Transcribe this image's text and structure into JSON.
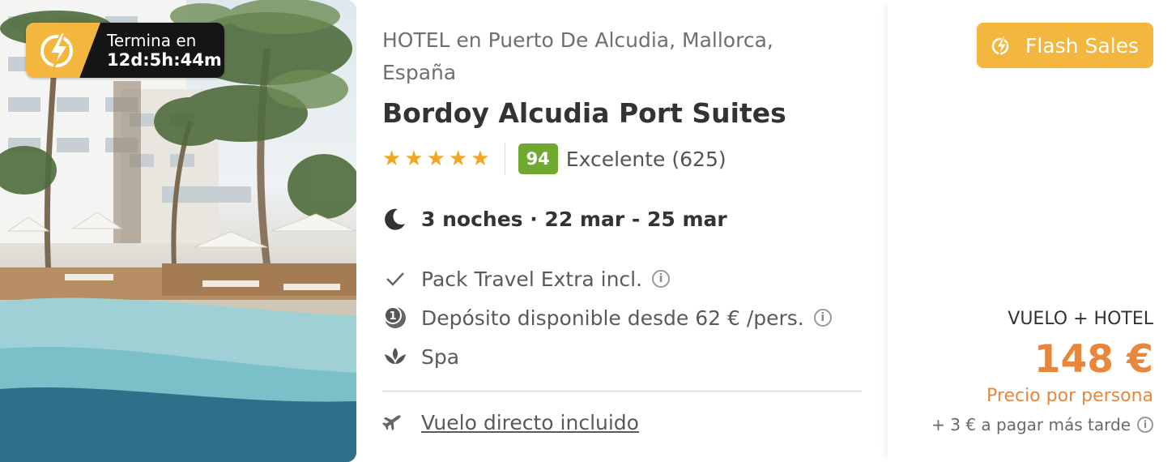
{
  "timer": {
    "label": "Termina en",
    "value": "12d:5h:44m",
    "icon": "flash-timer-icon"
  },
  "hotel": {
    "location": "HOTEL en Puerto De Alcudia, Mallorca, España",
    "name": "Bordoy Alcudia Port Suites",
    "stars": 5,
    "score": "94",
    "review_text": "Excelente (625)"
  },
  "stay": {
    "icon": "moon-icon",
    "dates": "3 noches · 22 mar - 25 mar"
  },
  "features": [
    {
      "icon": "check-icon",
      "text": "Pack Travel Extra incl.",
      "has_info": true
    },
    {
      "icon": "deposit-icon",
      "text": "Depósito disponible desde 62 € /pers.",
      "has_info": true
    },
    {
      "icon": "spa-icon",
      "text": "Spa",
      "has_info": false
    }
  ],
  "flight": {
    "icon": "plane-icon",
    "text": "Vuelo directo incluido"
  },
  "pricing": {
    "badge": "Flash Sales",
    "package_type": "VUELO + HOTEL",
    "price": "148 €",
    "per_person": "Precio por persona",
    "extra": "+ 3 € a pagar más tarde"
  },
  "colors": {
    "accent": "#f3b63f",
    "price": "#e8873c",
    "score": "#6fa92f",
    "star": "#f3a51f"
  }
}
